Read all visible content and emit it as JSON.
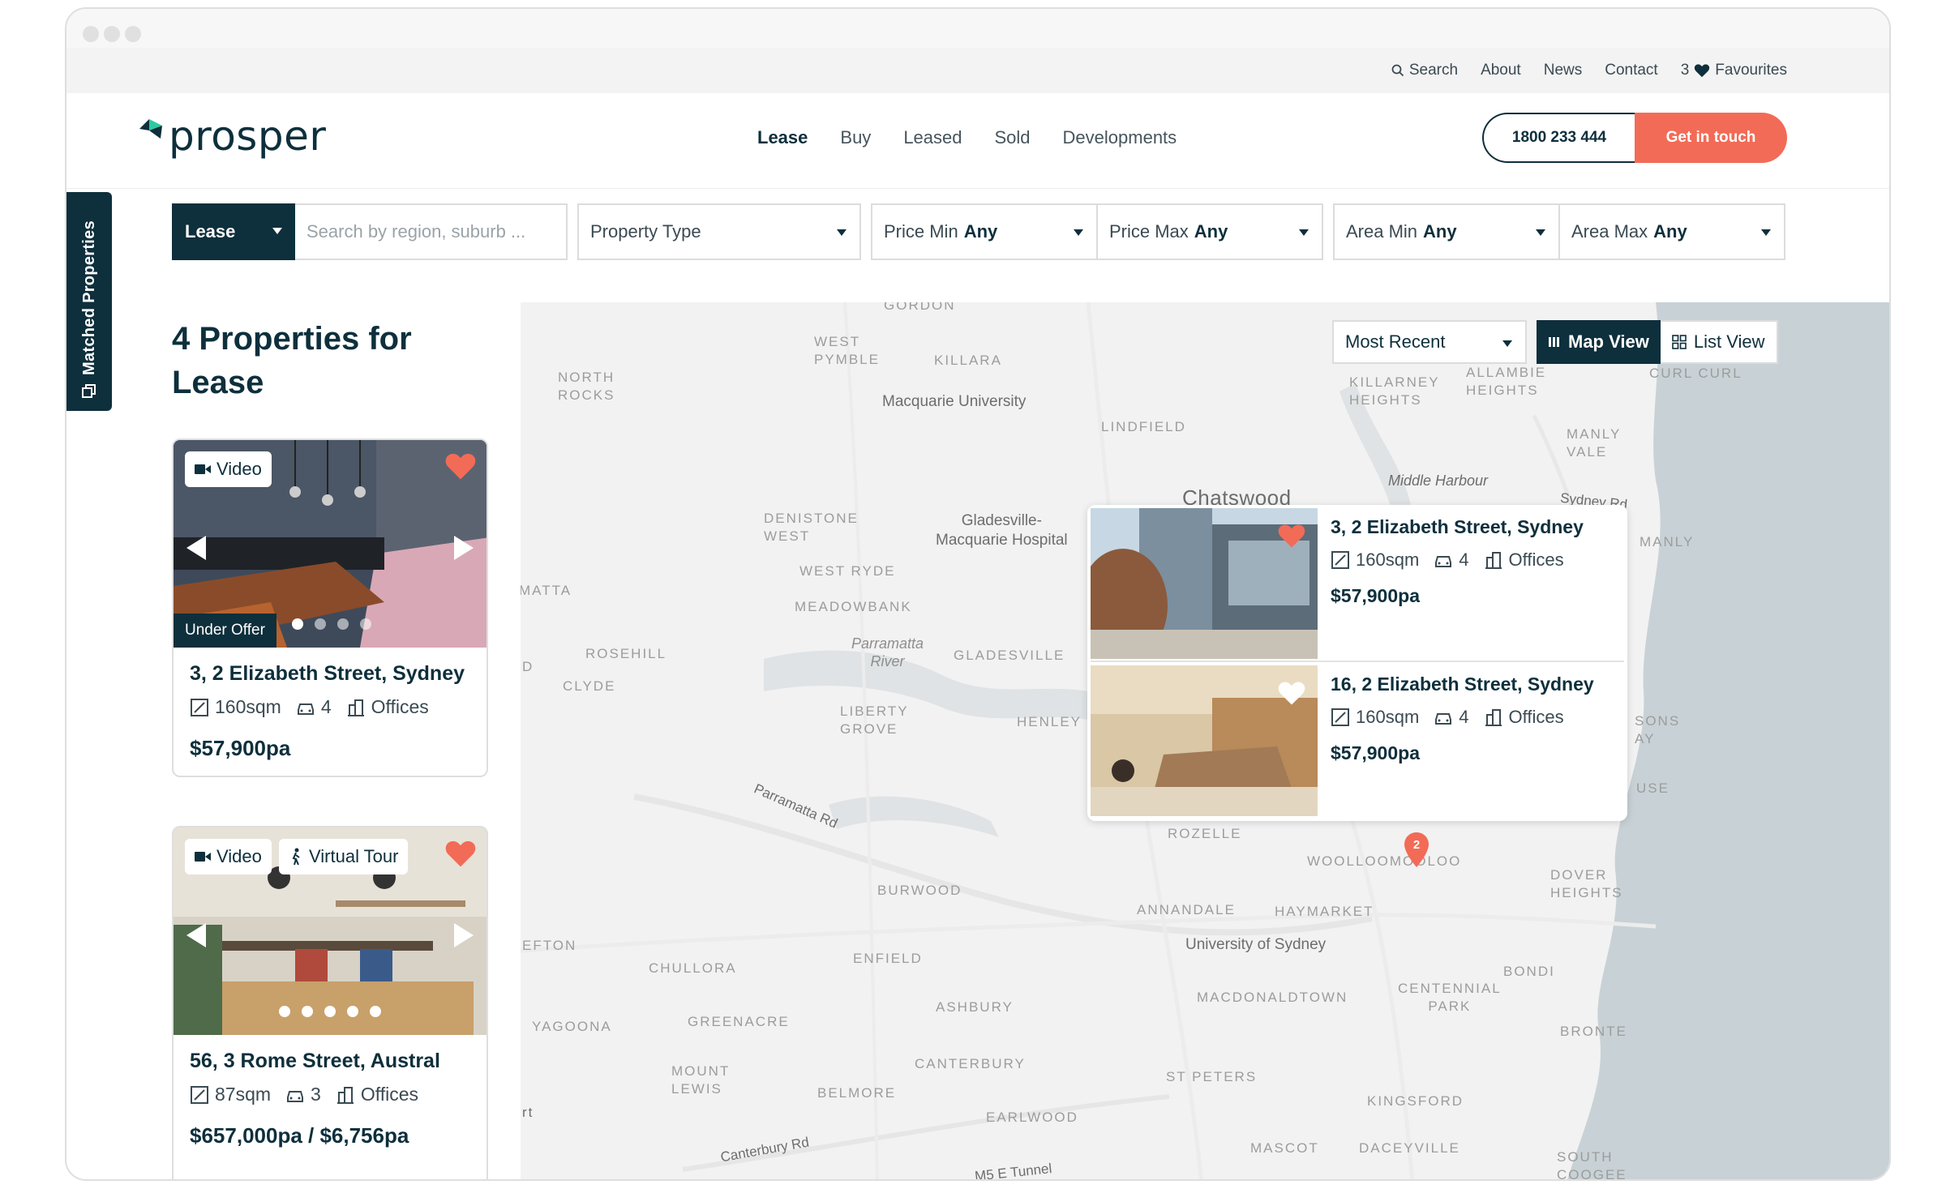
{
  "topbar": {
    "search": "Search",
    "about": "About",
    "news": "News",
    "contact": "Contact",
    "favourites_count": "3",
    "favourites": "Favourites"
  },
  "brand": {
    "name": "prosper",
    "color": "#0e2f3c",
    "accent": "#f26b57",
    "mark_green": "#2ec9a0"
  },
  "nav": {
    "lease": "Lease",
    "buy": "Buy",
    "leased": "Leased",
    "sold": "Sold",
    "developments": "Developments"
  },
  "header": {
    "phone": "1800 233 444",
    "cta": "Get in touch"
  },
  "side_tab": {
    "label": "Matched Properties"
  },
  "filters": {
    "listing_type": "Lease",
    "search_placeholder": "Search by region, suburb ...",
    "property_type": "Property Type",
    "price_min_label": "Price Min",
    "price_min_value": "Any",
    "price_max_label": "Price Max",
    "price_max_value": "Any",
    "area_min_label": "Area Min",
    "area_min_value": "Any",
    "area_max_label": "Area Max",
    "area_max_value": "Any"
  },
  "results": {
    "heading": "4 Properties for Lease"
  },
  "listings": [
    {
      "badges": [
        "Video"
      ],
      "status": "Under Offer",
      "title": "3, 2 Elizabeth Street, Sydney",
      "area": "160sqm",
      "parking": "4",
      "type": "Offices",
      "price": "$57,900pa",
      "favourite": true
    },
    {
      "badges": [
        "Video",
        "Virtual Tour"
      ],
      "status": "",
      "title": "56, 3 Rome Street, Austral",
      "area": "87sqm",
      "parking": "3",
      "type": "Offices",
      "price": "$657,000pa / $6,756pa",
      "favourite": true
    }
  ],
  "map": {
    "sort": "Most Recent",
    "map_view": "Map View",
    "list_view": "List View",
    "cluster_count": "2",
    "labels": {
      "gordon": "Gordon",
      "west_pymble": "West\nPymble",
      "killara": "Killara",
      "north_rocks": "North\nRocks",
      "macquarie_uni": "Macquarie University",
      "killarney_heights": "Killarney\nHeights",
      "allambie_heights": "Allambie\nHeights",
      "curl_curl": "Curl Curl",
      "lindfield": "Lindfield",
      "manly_vale": "Manly\nVale",
      "middle_harbour": "Middle Harbour",
      "chatswood": "Chatswood",
      "sydney_rd": "Sydney Rd",
      "denistone_west": "Denistone\nWest",
      "gladesville_hospital": "Gladesville-\nMacquarie Hospital",
      "manly": "Manly",
      "west_ryde": "West Ryde",
      "matta": "Matta",
      "meadowbank": "Meadowbank",
      "parramatta_river": "Parramatta\nRiver",
      "gladesville": "Gladesville",
      "rosehill": "Rosehill",
      "clyde": "Clyde",
      "liberty_grove": "Liberty\nGrove",
      "henley": "Henley",
      "parramatta_rd": "Parramatta Rd",
      "rozelle": "Rozelle",
      "woolloomooloo": "Woolloomooloo",
      "dover_heights": "Dover\nHeights",
      "burwood": "Burwood",
      "annandale": "Annandale",
      "haymarket": "Haymarket",
      "efton": "Efton",
      "university_sydney": "University of Sydney",
      "chullora": "Chullora",
      "enfield": "Enfield",
      "bondi": "Bondi",
      "centennial_park": "Centennial\nPark",
      "macdonaldtown": "Macdonaldtown",
      "ashbury": "Ashbury",
      "yagoona": "Yagoona",
      "greenacre": "Greenacre",
      "bronte": "Bronte",
      "mount_lewis": "Mount\nLewis",
      "canterbury": "Canterbury",
      "st_peters": "St Peters",
      "belmore": "Belmore",
      "kingsford": "Kingsford",
      "earlwood": "Earlwood",
      "mascot": "Mascot",
      "daceyville": "Daceyville",
      "south_coogee": "South\nCoogee",
      "canterbury_rd": "Canterbury Rd",
      "rt": "rt",
      "d": "D",
      "m5_tunnel": "M5 E Tunnel",
      "sons_ay": "Sons\nAy",
      "use": "use"
    }
  },
  "map_popup": [
    {
      "title": "3, 2 Elizabeth Street, Sydney",
      "area": "160sqm",
      "parking": "4",
      "type": "Offices",
      "price": "$57,900pa",
      "favourite": true
    },
    {
      "title": "16, 2 Elizabeth Street, Sydney",
      "area": "160sqm",
      "parking": "4",
      "type": "Offices",
      "price": "$57,900pa",
      "favourite": false
    }
  ],
  "icons": {
    "search": "search-icon",
    "heart": "heart-icon",
    "video": "video-camera-icon",
    "virtual_tour": "person-walking-icon",
    "area": "area-icon",
    "car": "car-icon",
    "building": "building-icon",
    "map": "map-icon",
    "grid": "grid-icon",
    "chevron_left": "chevron-left-icon",
    "chevron_right": "chevron-right-icon",
    "pin": "map-pin-icon"
  }
}
